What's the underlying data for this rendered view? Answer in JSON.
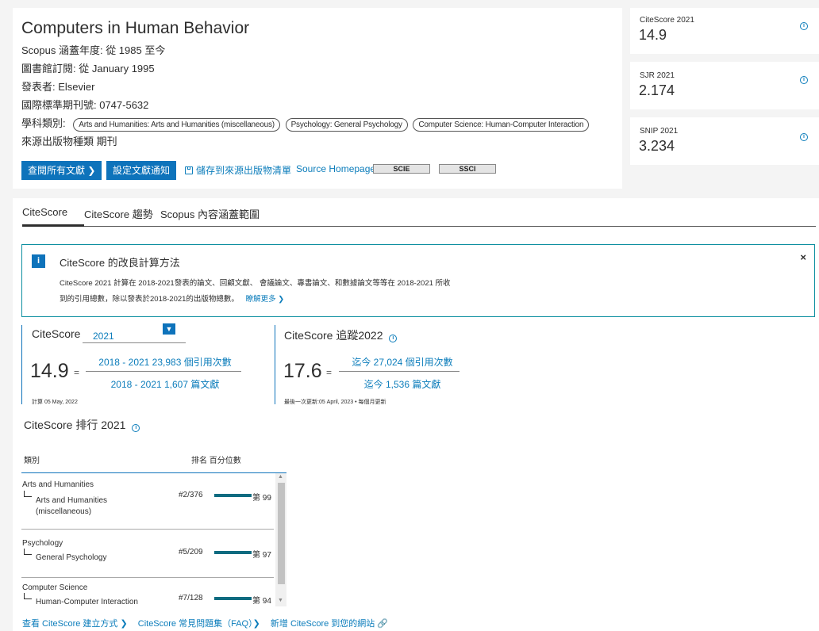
{
  "header": {
    "title": "Computers in Human Behavior",
    "coverage": "Scopus 涵蓋年度:  從 1985 至今",
    "library": "圖書館訂閱:  從 January 1995",
    "publisher": "發表者:  Elsevier",
    "issn": "國際標準期刊號:  0747-5632",
    "subject_label": "學科類別:",
    "subjects": [
      "Arts and Humanities: Arts and Humanities (miscellaneous)",
      "Psychology: General Psychology",
      "Computer Science: Human-Computer Interaction"
    ],
    "source_type": "來源出版物種類   期刊",
    "btn_view_docs": "查閱所有文獻 ❯",
    "btn_set_alert": "設定文獻通知",
    "save_list": "儲存到來源出版物清單",
    "source_homepage": "Source Homepage",
    "badge_scie": "SCIE",
    "badge_ssci": "SSCI"
  },
  "metrics": [
    {
      "label": "CiteScore 2021",
      "value": "14.9"
    },
    {
      "label": "SJR 2021",
      "value": "2.174"
    },
    {
      "label": "SNIP 2021",
      "value": "3.234"
    }
  ],
  "tabs": [
    "CiteScore",
    "CiteScore 趨勢",
    "Scopus 內容涵蓋範圍"
  ],
  "banner": {
    "icon": "i",
    "title": "CiteScore 的改良計算方法",
    "line1": "CiteScore 2021 計算在 2018-2021發表的論文、回顧文獻、 會議論文、專書論文、和數據論文等等在 2018-2021 所收",
    "line2_text": "到的引用總數，除以發表於2018-2021的出版物總數。",
    "line2_link": "瞭解更多 ❯",
    "close": "×"
  },
  "citescore": {
    "title": "CiteScore",
    "year": "2021",
    "value": "14.9",
    "numerator": "2018 - 2021 23,983 個引用次數",
    "denominator": "2018 - 2021 1,607 篇文獻",
    "note": "計算 05 May, 2022"
  },
  "tracker": {
    "title": "CiteScore 追蹤2022",
    "value": "17.6",
    "numerator": "迄今 27,024 個引用次數",
    "denominator": "迄今 1,536 篇文獻",
    "note": "最後一次更新:05 April, 2023 • 每個月更新"
  },
  "rank": {
    "title": "CiteScore 排行 2021",
    "head_category": "類別",
    "head_rank": "排名  百分位數",
    "rows": [
      {
        "category": "Arts and Humanities",
        "sub1": "Arts and Humanities",
        "sub2": "(miscellaneous)",
        "rank": "#2/376",
        "percentile": "第 99",
        "fill": 0.99
      },
      {
        "category": "Psychology",
        "sub1": "General Psychology",
        "sub2": "",
        "rank": "#5/209",
        "percentile": "第 97",
        "fill": 0.97
      },
      {
        "category": "Computer Science",
        "sub1": "Human-Computer Interaction",
        "sub2": "",
        "rank": "#7/128",
        "percentile": "第 94",
        "fill": 0.94
      }
    ]
  },
  "footer": {
    "link1": "查看 CiteScore 建立方式 ❯",
    "link2": "CiteScore 常見問題集（FAQ）❯",
    "link3": "新增 CiteScore 到您的網站 🔗"
  },
  "colors": {
    "accent": "#0e73bb",
    "bar": "#0e6b80",
    "link": "#0c7dbb",
    "banner_border": "#0c8fa0"
  }
}
